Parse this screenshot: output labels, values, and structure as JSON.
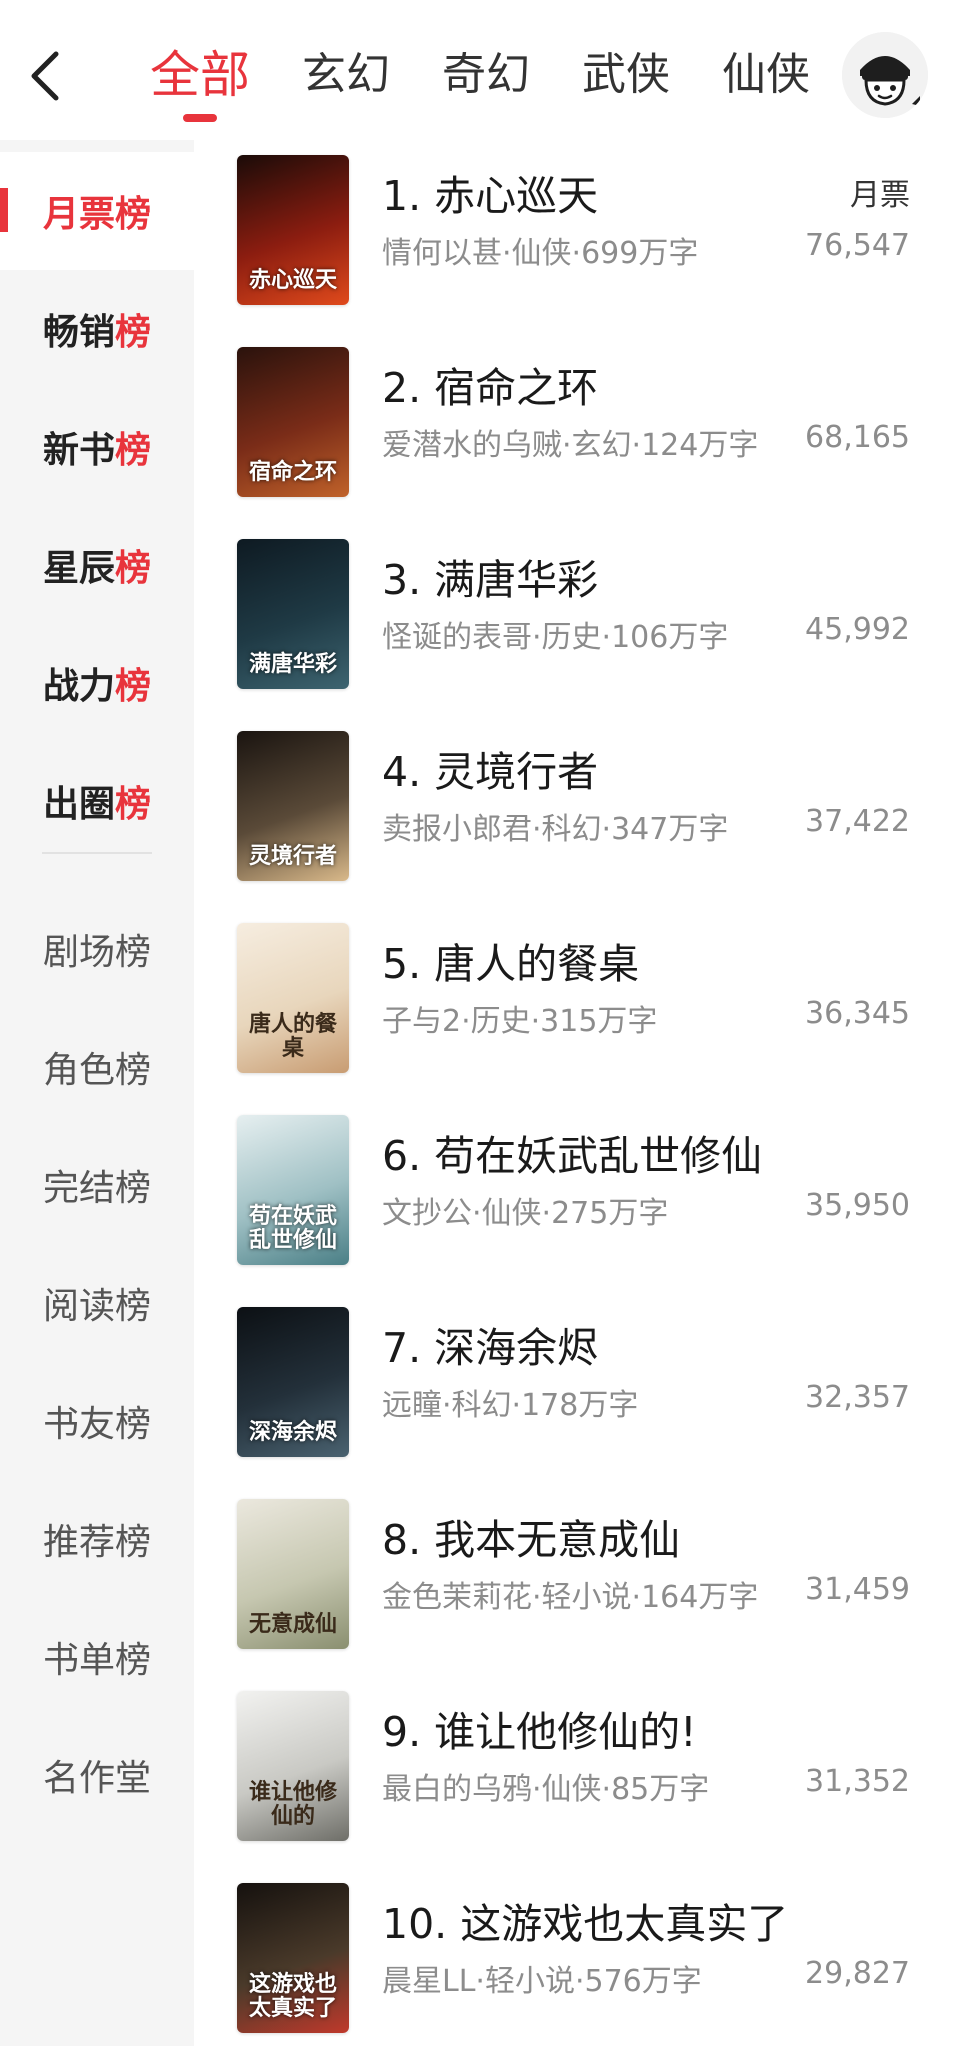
{
  "header": {
    "tabs": [
      "全部",
      "玄幻",
      "奇幻",
      "武侠",
      "仙侠"
    ],
    "active_tab": 0
  },
  "sidebar": {
    "items": [
      {
        "pre": "月票榜",
        "hi": ""
      },
      {
        "pre": "畅销",
        "hi": "榜"
      },
      {
        "pre": "新书",
        "hi": "榜"
      },
      {
        "pre": "星辰",
        "hi": "榜"
      },
      {
        "pre": "战力",
        "hi": "榜"
      },
      {
        "pre": "出圈",
        "hi": "榜"
      },
      {
        "pre": "剧场榜",
        "hi": ""
      },
      {
        "pre": "角色榜",
        "hi": ""
      },
      {
        "pre": "完结榜",
        "hi": ""
      },
      {
        "pre": "阅读榜",
        "hi": ""
      },
      {
        "pre": "书友榜",
        "hi": ""
      },
      {
        "pre": "推荐榜",
        "hi": ""
      },
      {
        "pre": "书单榜",
        "hi": ""
      },
      {
        "pre": "名作堂",
        "hi": ""
      }
    ]
  },
  "list": {
    "votes_label": "月票",
    "books": [
      {
        "title": "1. 赤心巡天",
        "meta": "情何以甚·仙侠·699万字",
        "votes": "76,547",
        "cover_text": "赤心巡天",
        "colors": [
          "#1a0b08",
          "#8c1d10",
          "#e04a1c"
        ]
      },
      {
        "title": "2. 宿命之环",
        "meta": "爱潜水的乌贼·玄幻·124万字",
        "votes": "68,165",
        "cover_text": "宿命之环",
        "colors": [
          "#2a120c",
          "#7a2c18",
          "#c0622a"
        ]
      },
      {
        "title": "3. 满唐华彩",
        "meta": "怪诞的表哥·历史·106万字",
        "votes": "45,992",
        "cover_text": "满唐华彩",
        "colors": [
          "#0e1a22",
          "#1f3a45",
          "#3d6470"
        ]
      },
      {
        "title": "4. 灵境行者",
        "meta": "卖报小郎君·科幻·347万字",
        "votes": "37,422",
        "cover_text": "灵境行者",
        "colors": [
          "#1a1410",
          "#5a4a38",
          "#d9b98a"
        ]
      },
      {
        "title": "5. 唐人的餐桌",
        "meta": "子与2·历史·315万字",
        "votes": "36,345",
        "cover_text": "唐人的餐桌",
        "colors": [
          "#f6ede0",
          "#e8d6bc",
          "#c89c72"
        ]
      },
      {
        "title": "6. 苟在妖武乱世修仙",
        "meta": "文抄公·仙侠·275万字",
        "votes": "35,950",
        "cover_text": "苟在妖武乱世修仙",
        "colors": [
          "#e6eff0",
          "#9fc0c4",
          "#4a7f86"
        ]
      },
      {
        "title": "7. 深海余烬",
        "meta": "远瞳·科幻·178万字",
        "votes": "32,357",
        "cover_text": "深海余烬",
        "colors": [
          "#0c1014",
          "#23303a",
          "#4a6270"
        ]
      },
      {
        "title": "8. 我本无意成仙",
        "meta": "金色茉莉花·轻小说·164万字",
        "votes": "31,459",
        "cover_text": "无意成仙",
        "colors": [
          "#ebe8de",
          "#c6c7b0",
          "#8a8f70"
        ]
      },
      {
        "title": "9. 谁让他修仙的!",
        "meta": "最白的乌鸦·仙侠·85万字",
        "votes": "31,352",
        "cover_text": "谁让他修仙的",
        "colors": [
          "#f2f2f0",
          "#c9c9c4",
          "#6e6e68"
        ]
      },
      {
        "title": "10. 这游戏也太真实了",
        "meta": "晨星LL·轻小说·576万字",
        "votes": "29,827",
        "cover_text": "这游戏也太真实了",
        "colors": [
          "#15110e",
          "#4a3a2a",
          "#c0392b"
        ]
      }
    ]
  }
}
